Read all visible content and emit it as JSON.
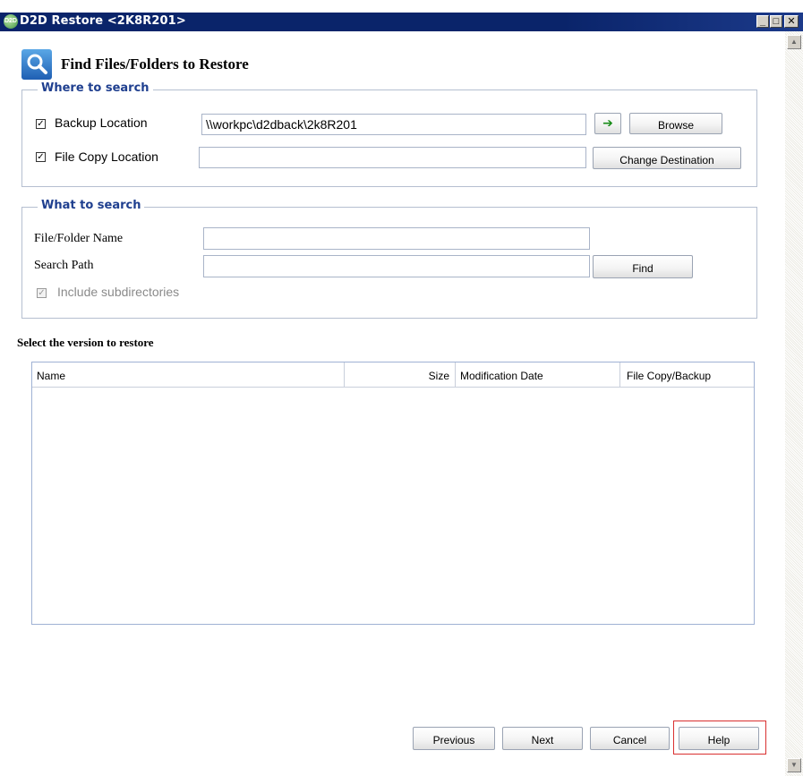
{
  "window": {
    "title": "D2D Restore <2K8R201>",
    "icon_text": "D2D",
    "controls": [
      "minimize-icon",
      "maximize-icon",
      "close-icon"
    ]
  },
  "header": {
    "title": "Find Files/Folders to Restore",
    "icon": "magnifier-icon"
  },
  "where_to_search": {
    "legend": "Where to search",
    "backup_location": {
      "label": "Backup Location",
      "checked": true,
      "value": "\\\\workpc\\d2dback\\2k8R201"
    },
    "go_icon": "green-arrow-icon",
    "browse_label": "Browse",
    "file_copy_location": {
      "label": "File Copy Location",
      "checked": true,
      "value": ""
    },
    "change_destination_label": "Change Destination"
  },
  "what_to_search": {
    "legend": "What to search",
    "file_folder_name_label": "File/Folder Name",
    "file_folder_name_value": "",
    "search_path_label": "Search Path",
    "search_path_value": "",
    "find_label": "Find",
    "include_subdirectories_label": "Include subdirectories",
    "include_subdirectories_checked": true
  },
  "results": {
    "title": "Select the version to restore",
    "columns": [
      "Name",
      "Size",
      "Modification Date",
      "File Copy/Backup"
    ],
    "rows": []
  },
  "footer": {
    "previous_label": "Previous",
    "next_label": "Next",
    "cancel_label": "Cancel",
    "help_label": "Help"
  },
  "colors": {
    "titlebar": "#0a246a",
    "legend_text": "#1f3f8f",
    "highlight_frame": "#d93030"
  }
}
